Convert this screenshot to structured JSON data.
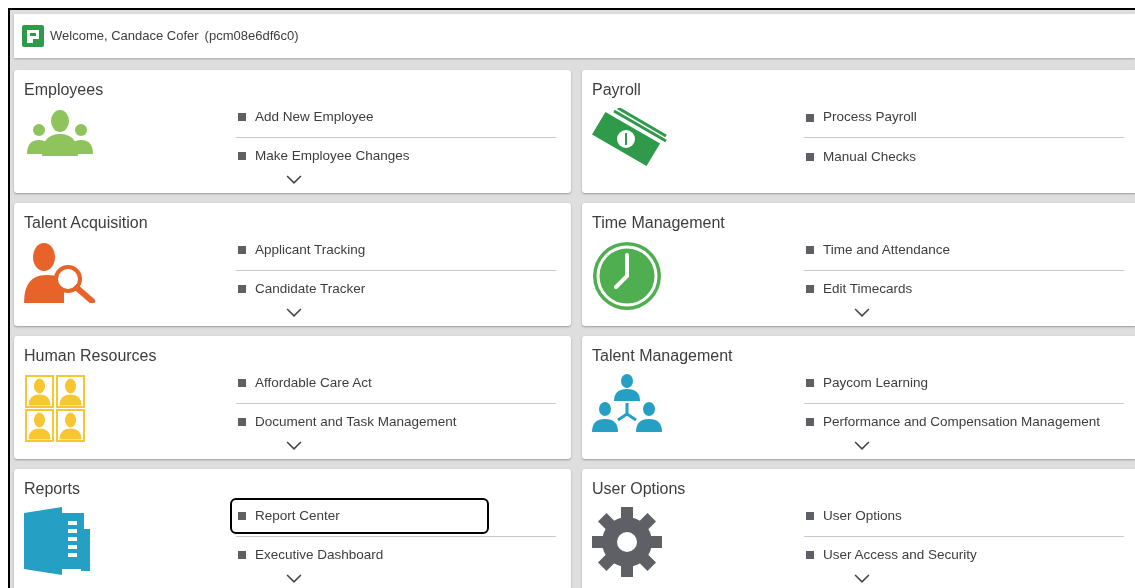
{
  "header": {
    "welcome": "Welcome, Candace Cofer",
    "user_id": "(pcm08e6df6c0)"
  },
  "cards": [
    {
      "title": "Employees",
      "kind": "people",
      "expandable": true,
      "links": [
        {
          "label": "Add New Employee",
          "highlighted": false
        },
        {
          "label": "Make Employee Changes",
          "highlighted": false
        }
      ]
    },
    {
      "title": "Payroll",
      "kind": "money",
      "expandable": false,
      "links": [
        {
          "label": "Process Payroll",
          "highlighted": false
        },
        {
          "label": "Manual Checks",
          "highlighted": false
        }
      ]
    },
    {
      "title": "Talent Acquisition",
      "kind": "search-person",
      "expandable": true,
      "links": [
        {
          "label": "Applicant Tracking",
          "highlighted": false
        },
        {
          "label": "Candidate Tracker",
          "highlighted": false
        }
      ]
    },
    {
      "title": "Time Management",
      "kind": "clock",
      "expandable": true,
      "links": [
        {
          "label": "Time and Attendance",
          "highlighted": false
        },
        {
          "label": "Edit Timecards",
          "highlighted": false
        }
      ]
    },
    {
      "title": "Human Resources",
      "kind": "portraits",
      "expandable": true,
      "links": [
        {
          "label": "Affordable Care Act",
          "highlighted": false
        },
        {
          "label": "Document and Task Management",
          "highlighted": false
        }
      ]
    },
    {
      "title": "Talent Management",
      "kind": "team",
      "expandable": true,
      "links": [
        {
          "label": "Paycom Learning",
          "highlighted": false
        },
        {
          "label": "Performance and Compensation Management",
          "highlighted": false
        }
      ]
    },
    {
      "title": "Reports",
      "kind": "book",
      "expandable": true,
      "links": [
        {
          "label": "Report Center",
          "highlighted": true
        },
        {
          "label": "Executive Dashboard",
          "highlighted": false
        }
      ]
    },
    {
      "title": "User Options",
      "kind": "gear",
      "expandable": true,
      "links": [
        {
          "label": "User Options",
          "highlighted": false
        },
        {
          "label": "User Access and Security",
          "highlighted": false
        }
      ]
    }
  ]
}
